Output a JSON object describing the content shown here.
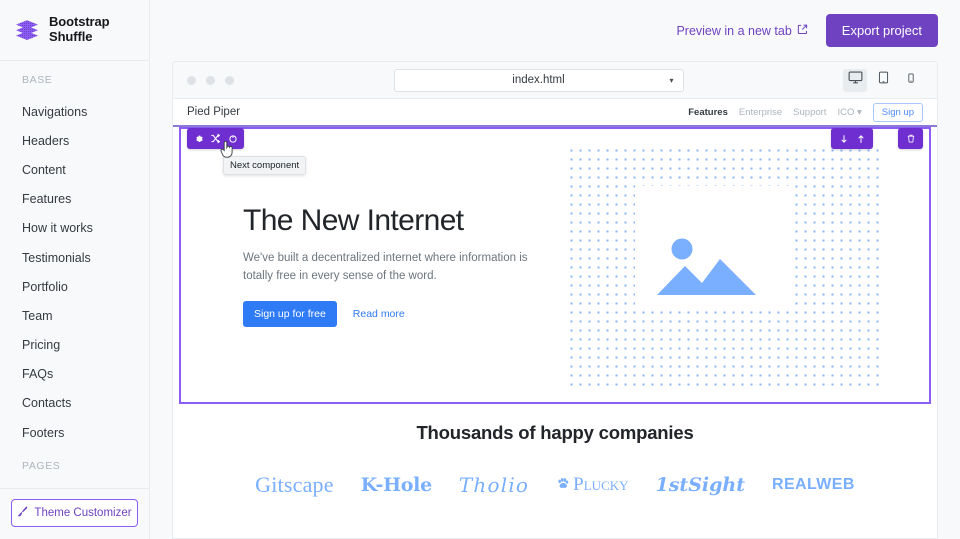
{
  "app": {
    "brand_line1": "Bootstrap",
    "brand_line2": "Shuffle",
    "logo_icon": "layers-stack-icon",
    "accent": "#6f42c1",
    "accent_dark": "#6f2ecf"
  },
  "sidebar": {
    "heading_base": "BASE",
    "heading_pages": "PAGES",
    "items": [
      {
        "label": "Navigations"
      },
      {
        "label": "Headers"
      },
      {
        "label": "Content"
      },
      {
        "label": "Features"
      },
      {
        "label": "How it works"
      },
      {
        "label": "Testimonials"
      },
      {
        "label": "Portfolio"
      },
      {
        "label": "Team"
      },
      {
        "label": "Pricing"
      },
      {
        "label": "FAQs"
      },
      {
        "label": "Contacts"
      },
      {
        "label": "Footers"
      }
    ],
    "theme_button": {
      "label": "Theme Customizer",
      "icon": "paint-brush-icon"
    }
  },
  "topbar": {
    "preview_label": "Preview in a new tab",
    "preview_icon": "external-link-icon",
    "export_label": "Export project"
  },
  "browser_bar": {
    "dots": [
      "window-dot-1",
      "window-dot-2",
      "window-dot-3"
    ],
    "file_value": "index.html",
    "file_caret": "▾",
    "devices": [
      {
        "name": "desktop-view",
        "icon": "desktop-icon",
        "active": true
      },
      {
        "name": "tablet-view",
        "icon": "tablet-icon",
        "active": false
      },
      {
        "name": "mobile-view",
        "icon": "mobile-icon",
        "active": false
      }
    ]
  },
  "preview_site": {
    "brand": "Pied Piper",
    "nav_links": [
      {
        "label": "Features",
        "active": true
      },
      {
        "label": "Enterprise",
        "active": false
      },
      {
        "label": "Support",
        "active": false
      },
      {
        "label": "ICO ▾",
        "active": false
      }
    ],
    "signup_label": "Sign up"
  },
  "component_toolbar": {
    "left_buttons": [
      {
        "name": "component-settings-button",
        "icon": "gear-icon"
      },
      {
        "name": "shuffle-component-button",
        "icon": "shuffle-icon"
      },
      {
        "name": "next-component-button",
        "icon": "refresh-next-icon"
      }
    ],
    "tooltip": "Next component",
    "move_buttons": [
      {
        "name": "move-down-button",
        "icon": "arrow-down-icon",
        "glyph": "↓"
      },
      {
        "name": "move-up-button",
        "icon": "arrow-up-icon",
        "glyph": "↑"
      }
    ],
    "delete_button": {
      "name": "delete-component-button",
      "icon": "trash-icon"
    }
  },
  "hero": {
    "title": "The New Internet",
    "subtitle": "We've built a decentralized internet where information is totally free in every sense of the word.",
    "cta_label": "Sign up for free",
    "link_label": "Read more",
    "image_placeholder_icon": "image-placeholder-icon"
  },
  "companies": {
    "title": "Thousands of happy companies",
    "logos": [
      {
        "name": "logo-gitscape",
        "text": "Gitscape"
      },
      {
        "name": "logo-k-hole",
        "text": "K-Hole"
      },
      {
        "name": "logo-tholio",
        "text": "Tholio"
      },
      {
        "name": "logo-plucky",
        "text": "Plucky",
        "icon": "paw-icon"
      },
      {
        "name": "logo-1stsight",
        "text": "1stSight"
      },
      {
        "name": "logo-realweb",
        "text": "REALWEB"
      }
    ]
  }
}
